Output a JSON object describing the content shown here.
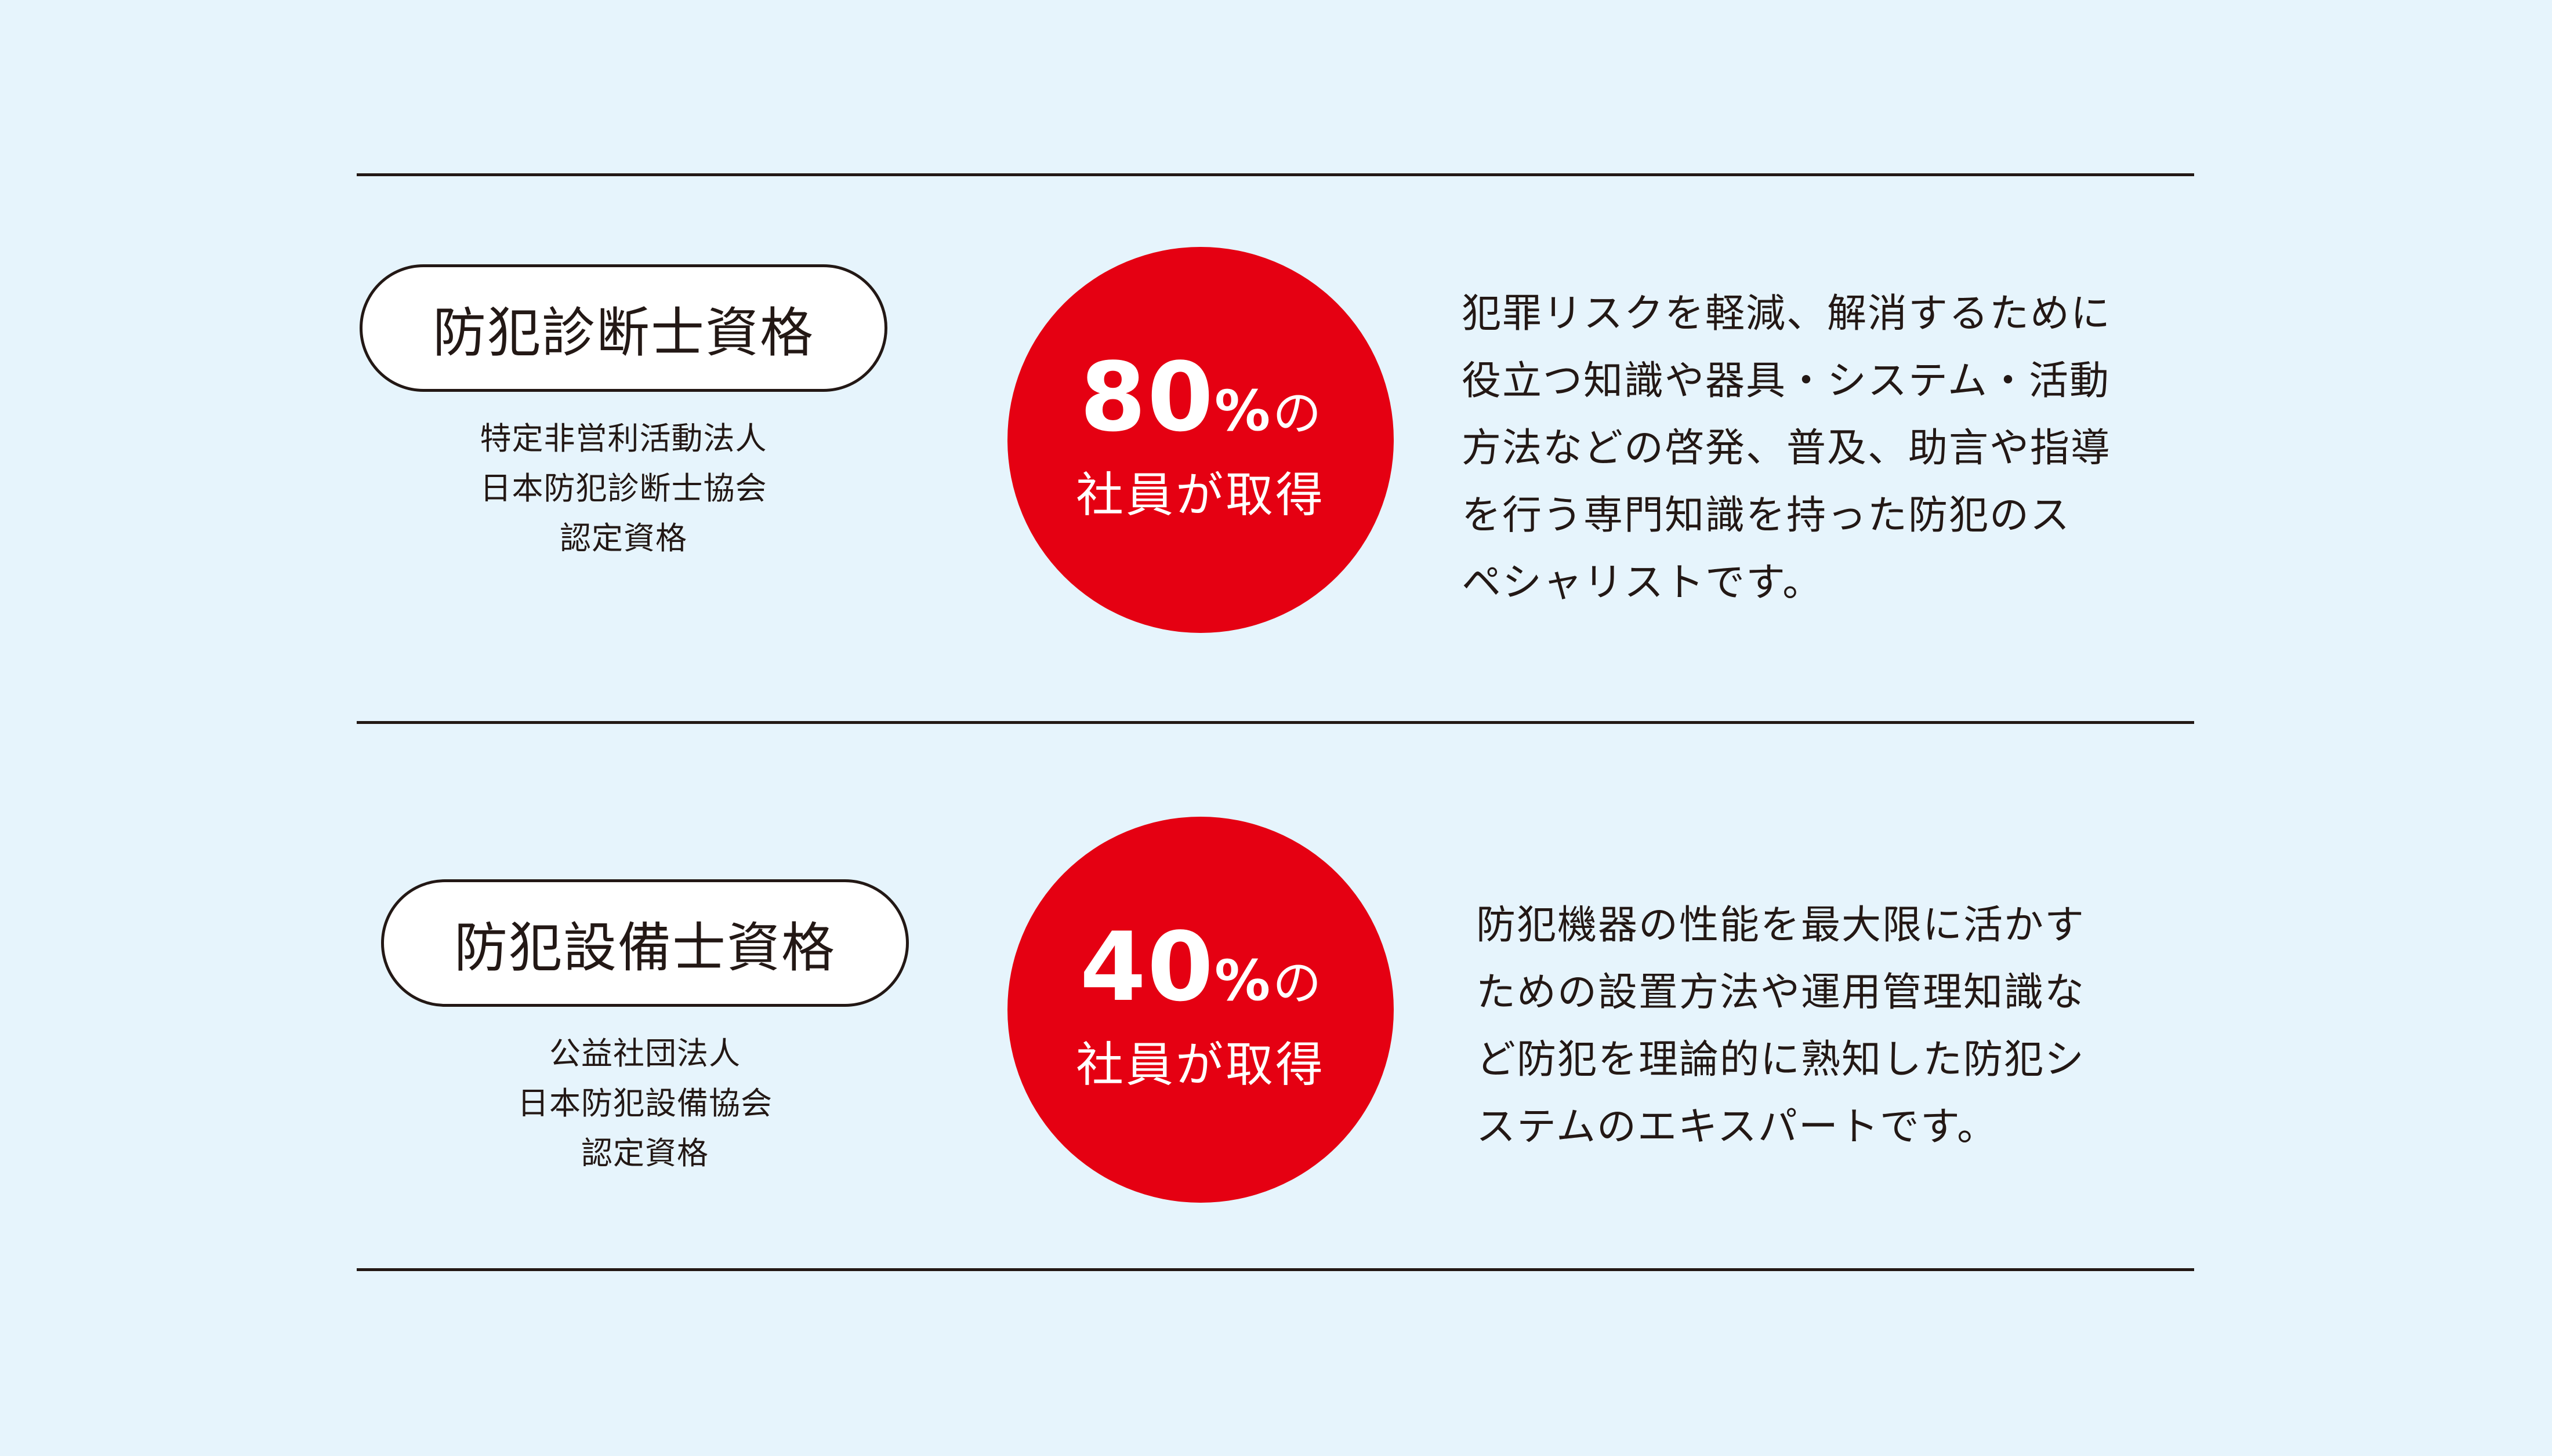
{
  "items": [
    {
      "title": "防犯診断士資格",
      "org_lines": [
        "特定非営利活動法人",
        "日本防犯診断士協会",
        "認定資格"
      ],
      "percent_value": "80",
      "percent_sign": "%",
      "percent_particle": "の",
      "badge_caption": "社員が取得",
      "description_lines": [
        "犯罪リスクを軽減、解消するために",
        "役立つ知識や器具・システム・活動",
        "方法などの啓発、普及、助言や指導",
        "を行う専門知識を持った防犯のス",
        "ペシャリストです。"
      ]
    },
    {
      "title": "防犯設備士資格",
      "org_lines": [
        "公益社団法人",
        "日本防犯設備協会",
        "認定資格"
      ],
      "percent_value": "40",
      "percent_sign": "%",
      "percent_particle": "の",
      "badge_caption": "社員が取得",
      "description_lines": [
        "防犯機器の性能を最大限に活かす",
        "ための設置方法や運用管理知識な",
        "ど防犯を理論的に熟知した防犯シ",
        "ステムのエキスパートです。"
      ]
    }
  ],
  "colors": {
    "background": "#e6f4fc",
    "badge": "#e50012",
    "text": "#231815"
  }
}
